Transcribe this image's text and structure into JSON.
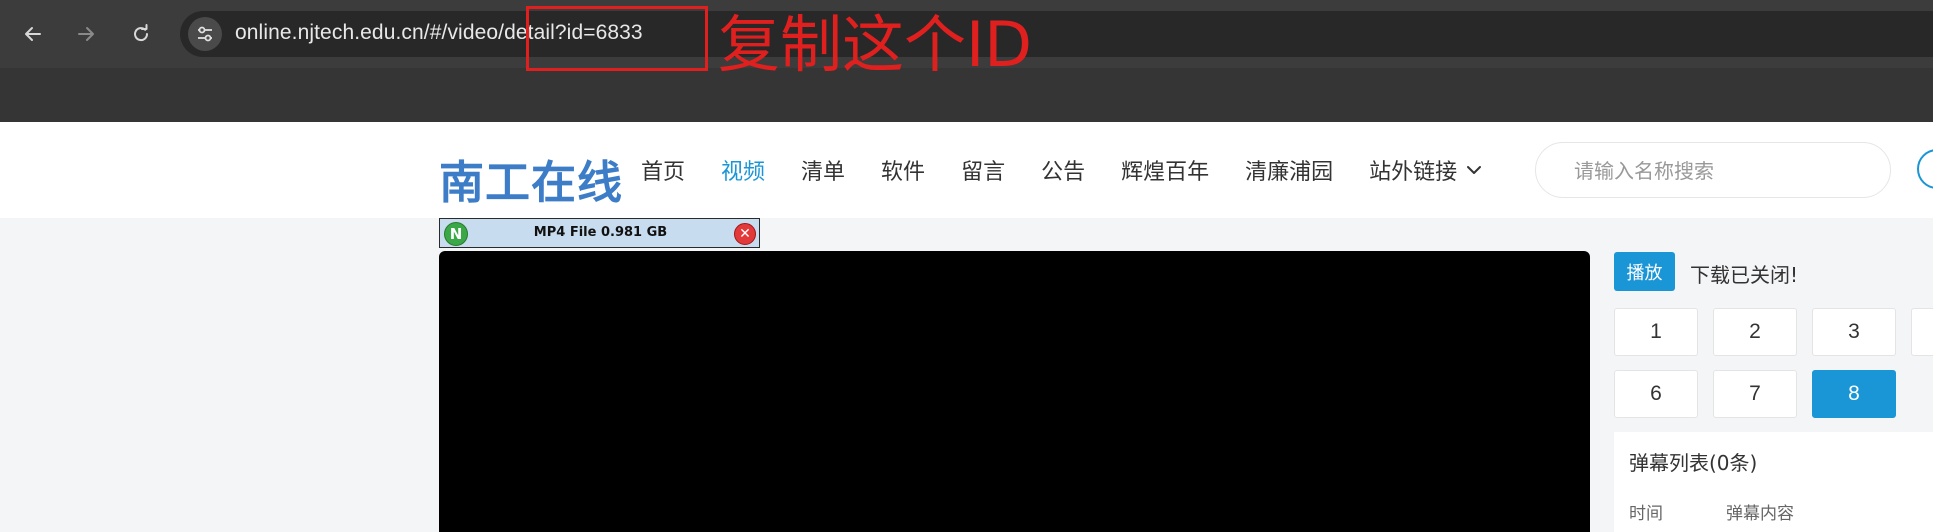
{
  "browser": {
    "url": "online.njtech.edu.cn/#/video/detail?id=6833",
    "back_icon": "arrow-left-icon",
    "forward_icon": "arrow-right-icon",
    "reload_icon": "reload-icon",
    "site_info_icon": "tune-icon"
  },
  "annotation": {
    "text": "复制这个ID",
    "color": "#e0201e"
  },
  "site": {
    "logo": "南工在线",
    "nav": [
      {
        "label": "首页",
        "active": false
      },
      {
        "label": "视频",
        "active": true
      },
      {
        "label": "清单",
        "active": false
      },
      {
        "label": "软件",
        "active": false
      },
      {
        "label": "留言",
        "active": false
      },
      {
        "label": "公告",
        "active": false
      },
      {
        "label": "辉煌百年",
        "active": false
      },
      {
        "label": "清廉浦园",
        "active": false
      },
      {
        "label": "站外链接",
        "active": false
      }
    ],
    "search_placeholder": "请输入名称搜索",
    "accent_color": "#1a95d6"
  },
  "plugin": {
    "label": "MP4 File 0.981 GB",
    "badge": "N"
  },
  "panel": {
    "play_label": "播放",
    "download_status": "下载已关闭!",
    "episodes": [
      "1",
      "2",
      "3",
      "6",
      "7",
      "8"
    ],
    "active_episode": "8",
    "danmu_title": "弹幕列表(0条)",
    "danmu_cols": [
      "时间",
      "弹幕内容"
    ]
  }
}
